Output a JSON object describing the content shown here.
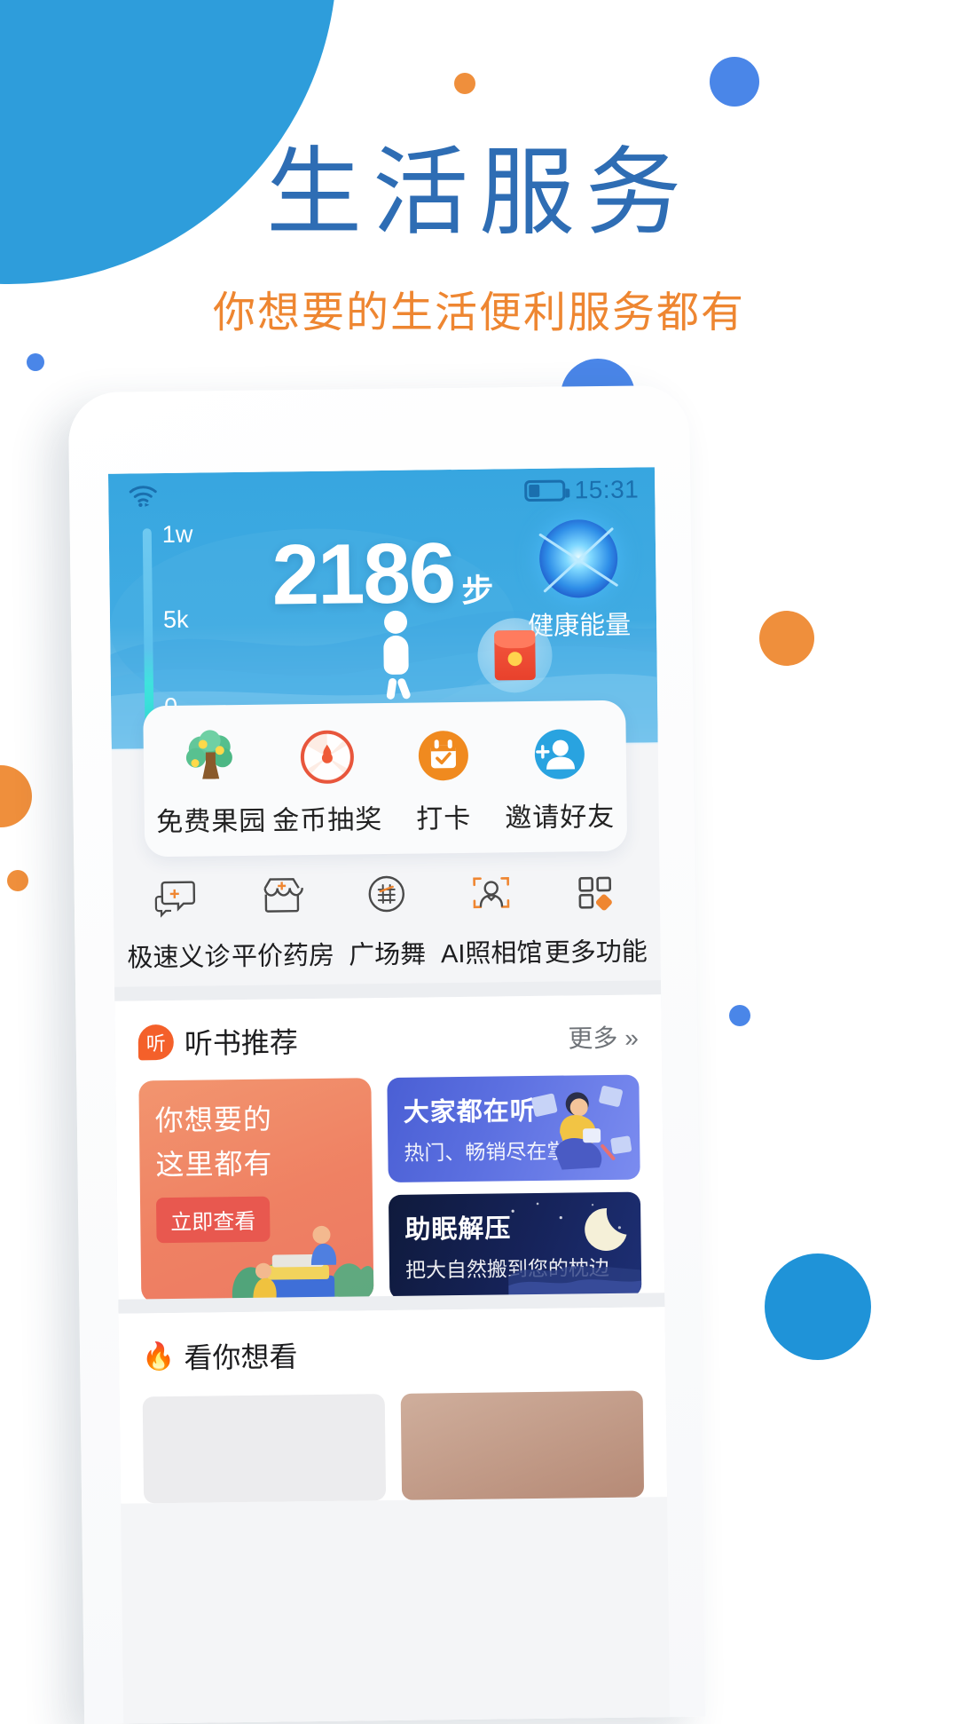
{
  "header": {
    "title": "生活服务",
    "subtitle": "你想要的生活便利服务都有",
    "title_color": "#2e6db4",
    "subtitle_color": "#ee8631"
  },
  "phone": {
    "statusbar": {
      "wifi_icon": "wifi-icon",
      "battery_icon": "battery-icon",
      "battery_level": "32",
      "time": "15:31"
    },
    "hero": {
      "steps_value": "2186",
      "steps_unit": "步",
      "gauge_labels": [
        "1w",
        "5k",
        "0"
      ],
      "energy_label": "健康能量",
      "energy_icon": "energy-orb-icon",
      "walker_icon": "walking-person-icon",
      "redpacket_icon": "red-packet-icon"
    },
    "quick_actions": [
      {
        "label": "免费果园",
        "icon": "tree-icon"
      },
      {
        "label": "金币抽奖",
        "icon": "lottery-wheel-icon"
      },
      {
        "label": "打卡",
        "icon": "calendar-check-icon"
      },
      {
        "label": "邀请好友",
        "icon": "invite-friend-icon"
      }
    ],
    "features": [
      {
        "label": "极速义诊",
        "icon": "chat-plus-icon"
      },
      {
        "label": "平价药房",
        "icon": "pharmacy-shop-icon"
      },
      {
        "label": "广场舞",
        "icon": "dance-circle-icon"
      },
      {
        "label": "AI照相馆",
        "icon": "portrait-scan-icon"
      },
      {
        "label": "更多功能",
        "icon": "grid-more-icon"
      }
    ],
    "listen_section": {
      "badge": "听",
      "title": "听书推荐",
      "more": "更多",
      "more_icon": "chevron-double-right-icon",
      "card_left": {
        "line1": "你想要的",
        "line2": "这里都有",
        "button": "立即查看",
        "bg_color": "#ef8163"
      },
      "card_top": {
        "title": "大家都在听",
        "subtitle": "热门、畅销尽在掌握",
        "bg_color": "#5b6fe0"
      },
      "card_bottom": {
        "title": "助眠解压",
        "subtitle": "把大自然搬到您的枕边",
        "bg_color": "#16235a"
      }
    },
    "watch_section": {
      "fire_icon": "fire-icon",
      "title": "看你想看"
    }
  }
}
